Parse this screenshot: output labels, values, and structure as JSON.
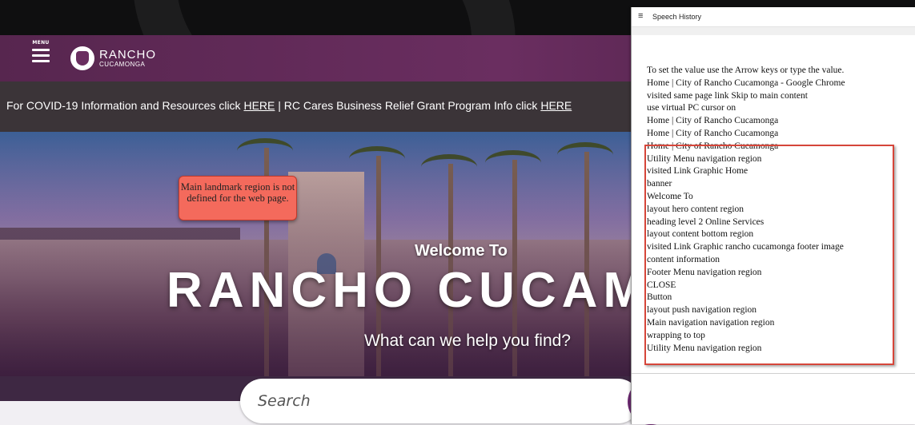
{
  "header": {
    "menu_label": "MENU",
    "logo_line1": "RANCHO",
    "logo_line2": "CUCAMONGA"
  },
  "covid_bar": {
    "text1": "For COVID-19 Information and Resources click ",
    "link1": "HERE",
    "text2": " | RC Cares Business Relief Grant Program Info click ",
    "link2": "HERE"
  },
  "hero": {
    "welcome": "Welcome To",
    "city_name": "RANCHO CUCAMO",
    "help_text": "What can we help you find?"
  },
  "callout": {
    "text": "Main landmark region is not defined for the web page."
  },
  "search": {
    "placeholder": "Search",
    "button_icon": "search-icon",
    "button_color": "#6e2a73"
  },
  "speech_history": {
    "title": "Speech History",
    "title_icon": "menu-lines-icon",
    "lines": [
      "To set the value use the Arrow keys or type the value.",
      "Home | City of Rancho Cucamonga - Google Chrome",
      "visited same page link Skip to main content",
      "use virtual PC cursor on",
      "Home | City of Rancho Cucamonga",
      "Home | City of Rancho Cucamonga",
      "Home | City of Rancho Cucamonga",
      "Utility Menu navigation region",
      "visited Link Graphic Home",
      "banner",
      "Welcome To",
      "layout hero content region",
      "heading level 2 Online Services",
      "layout content bottom region",
      "visited Link Graphic rancho cucamonga footer image",
      "content information",
      "Footer Menu navigation region",
      "CLOSE",
      "Button",
      "layout push navigation region",
      "Main navigation navigation region",
      "wrapping to top",
      "Utility Menu navigation region"
    ],
    "highlight_color": "#d6463a"
  },
  "colors": {
    "header_purple": "#6a2e60",
    "covid_bar": "#3b3438",
    "callout_bg": "#f46a5c"
  }
}
